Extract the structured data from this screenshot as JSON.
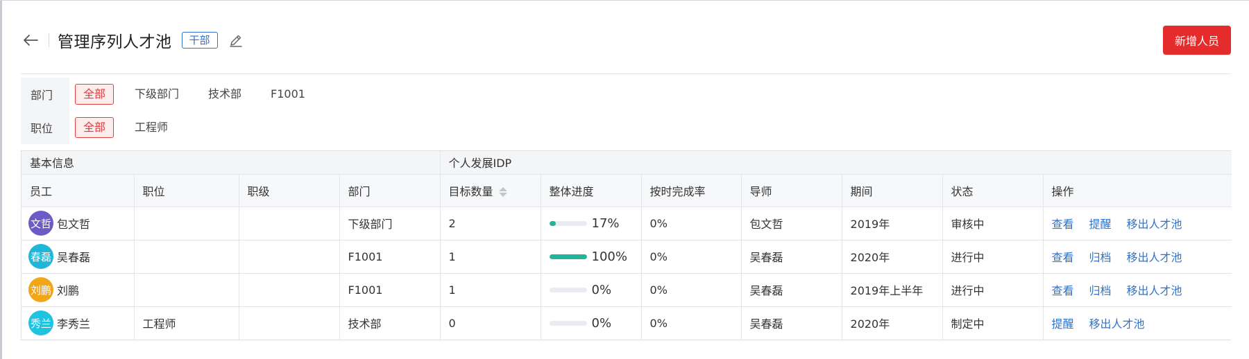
{
  "header": {
    "title": "管理序列人才池",
    "tag": "干部",
    "add_button": "新增人员"
  },
  "filters": [
    {
      "label": "部门",
      "options": [
        "全部",
        "下级部门",
        "技术部",
        "F1001"
      ],
      "active": 0
    },
    {
      "label": "职位",
      "options": [
        "全部",
        "工程师"
      ],
      "active": 0
    }
  ],
  "table": {
    "groups": [
      "基本信息",
      "个人发展IDP"
    ],
    "columns": [
      "员工",
      "职位",
      "职级",
      "部门",
      "目标数量",
      "整体进度",
      "按时完成率",
      "导师",
      "期间",
      "状态",
      "操作"
    ],
    "rows": [
      {
        "avatar": "文哲",
        "avatar_color": "#6a5bc7",
        "name": "包文哲",
        "position": "",
        "level": "",
        "dept": "下级部门",
        "goals": "2",
        "progress": 17,
        "progress_text": "17%",
        "ontime": "0%",
        "mentor": "包文哲",
        "period": "2019年",
        "status": "审核中",
        "actions": [
          "查看",
          "提醒",
          "移出人才池"
        ]
      },
      {
        "avatar": "春磊",
        "avatar_color": "#1fb6d9",
        "name": "吴春磊",
        "position": "",
        "level": "",
        "dept": "F1001",
        "goals": "1",
        "progress": 100,
        "progress_text": "100%",
        "ontime": "0%",
        "mentor": "吴春磊",
        "period": "2020年",
        "status": "进行中",
        "actions": [
          "查看",
          "归档",
          "移出人才池"
        ]
      },
      {
        "avatar": "刘鹏",
        "avatar_color": "#f2a517",
        "name": "刘鹏",
        "position": "",
        "level": "",
        "dept": "F1001",
        "goals": "1",
        "progress": 0,
        "progress_text": "0%",
        "ontime": "0%",
        "mentor": "吴春磊",
        "period": "2019年上半年",
        "status": "进行中",
        "actions": [
          "查看",
          "归档",
          "移出人才池"
        ]
      },
      {
        "avatar": "秀兰",
        "avatar_color": "#1fc2e0",
        "name": "李秀兰",
        "position": "工程师",
        "level": "",
        "dept": "技术部",
        "goals": "0",
        "progress": 0,
        "progress_text": "0%",
        "ontime": "0%",
        "mentor": "吴春磊",
        "period": "2020年",
        "status": "制定中",
        "actions": [
          "提醒",
          "移出人才池"
        ]
      }
    ]
  },
  "colors": {
    "primary": "#e42c2c",
    "link": "#2f72c9",
    "tag": "#2f6fd6",
    "progress": "#22b49a"
  },
  "icons": {
    "back": "arrow-left-icon",
    "edit": "edit-icon",
    "sort": "sort-icon"
  }
}
